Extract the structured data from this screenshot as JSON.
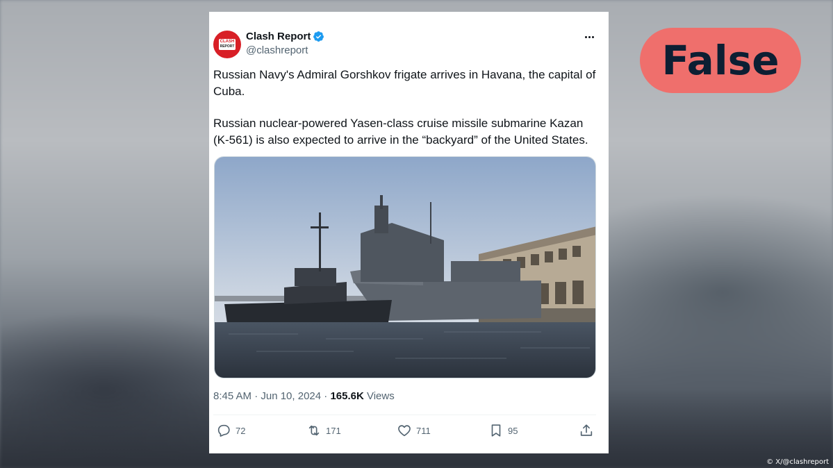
{
  "tweet": {
    "author_name": "Clash Report",
    "author_handle": "@clashreport",
    "avatar_text": [
      "CLASH",
      "REPORT"
    ],
    "paragraphs": [
      "Russian Navy's Admiral Gorshkov frigate arrives in Havana, the capital of Cuba.",
      "Russian nuclear-powered Yasen-class cruise missile submarine Kazan (K-561) is also expected to arrive in the “backyard” of the United States."
    ],
    "time": "8:45 AM · Jun 10, 2024 · ",
    "views_count": "165.6K",
    "views_label": " Views",
    "actions": {
      "replies": "72",
      "reposts": "171",
      "likes": "711",
      "bookmarks": "95"
    }
  },
  "verdict": "False",
  "credit": "© X/@clashreport",
  "colors": {
    "verdict_bg": "#ef6f6c",
    "verdict_text": "#0d1f33",
    "verified": "#1d9bf0",
    "avatar": "#d81f26"
  },
  "icons": [
    "more-icon",
    "verified-icon",
    "reply-icon",
    "repost-icon",
    "like-icon",
    "bookmark-icon",
    "share-icon"
  ]
}
